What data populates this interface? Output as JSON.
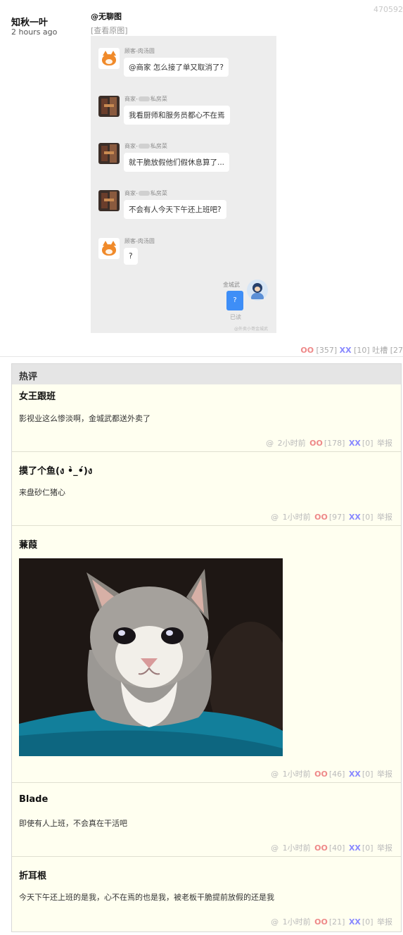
{
  "post": {
    "author": "知秋一叶",
    "time": "2 hours ago",
    "post_id": "470592",
    "mention": "@无聊图",
    "view_original": "[查看原图]",
    "chat": {
      "messages": [
        {
          "sender": "顾客-肉汤圆",
          "text": "@商家 怎么接了单又取消了?"
        },
        {
          "sender_prefix": "商家-",
          "sender_suffix": "私房菜",
          "text": "我看厨师和服务员都心不在焉"
        },
        {
          "sender_prefix": "商家-",
          "sender_suffix": "私房菜",
          "text": "就干脆放假他们假休息算了..."
        },
        {
          "sender_prefix": "商家-",
          "sender_suffix": "私房菜",
          "text": "不会有人今天下午还上班吧?"
        },
        {
          "sender": "顾客-肉汤圆",
          "text": "?"
        }
      ],
      "self_name": "金城武",
      "self_text": "?",
      "read_label": "已读",
      "watermark": "@外卖小哥金城武"
    },
    "stats": {
      "oo_label": "OO",
      "oo_count": "[357]",
      "xx_label": "XX",
      "xx_count": "[10]",
      "tucao": "吐槽 [27"
    }
  },
  "hot_comments": {
    "title": "热评",
    "items": [
      {
        "author": "女王跟班",
        "text": "影视业这么惨淡啊，金城武都送外卖了",
        "at": "@",
        "time": "2小时前",
        "oo": "OO",
        "oo_count": "[178]",
        "xx": "XX",
        "xx_count": "[0]",
        "report": "举报"
      },
      {
        "author": "摸了个鱼(ง •̀_•́)ง",
        "text": "来盘砂仁猪心",
        "at": "@",
        "time": "1小时前",
        "oo": "OO",
        "oo_count": "[97]",
        "xx": "XX",
        "xx_count": "[0]",
        "report": "举报"
      },
      {
        "author": "蒹葭",
        "text": "",
        "image": "crying-cat-photo",
        "at": "@",
        "time": "1小时前",
        "oo": "OO",
        "oo_count": "[46]",
        "xx": "XX",
        "xx_count": "[0]",
        "report": "举报"
      },
      {
        "author": "Blade",
        "text": "即使有人上班，不会真在干活吧",
        "at": "@",
        "time": "1小时前",
        "oo": "OO",
        "oo_count": "[40]",
        "xx": "XX",
        "xx_count": "[0]",
        "report": "举报"
      },
      {
        "author": "折耳根",
        "text": "今天下午还上班的是我，心不在焉的也是我，被老板干脆提前放假的还是我",
        "at": "@",
        "time": "1小时前",
        "oo": "OO",
        "oo_count": "[21]",
        "xx": "XX",
        "xx_count": "[0]",
        "report": "举报"
      }
    ]
  },
  "colors": {
    "oo": "#ee8888",
    "xx": "#8888ff",
    "comment_bg": "#fffff0",
    "header_bg": "#e5e5e5",
    "chat_bg": "#ededed",
    "self_bubble": "#3e8ef7"
  }
}
